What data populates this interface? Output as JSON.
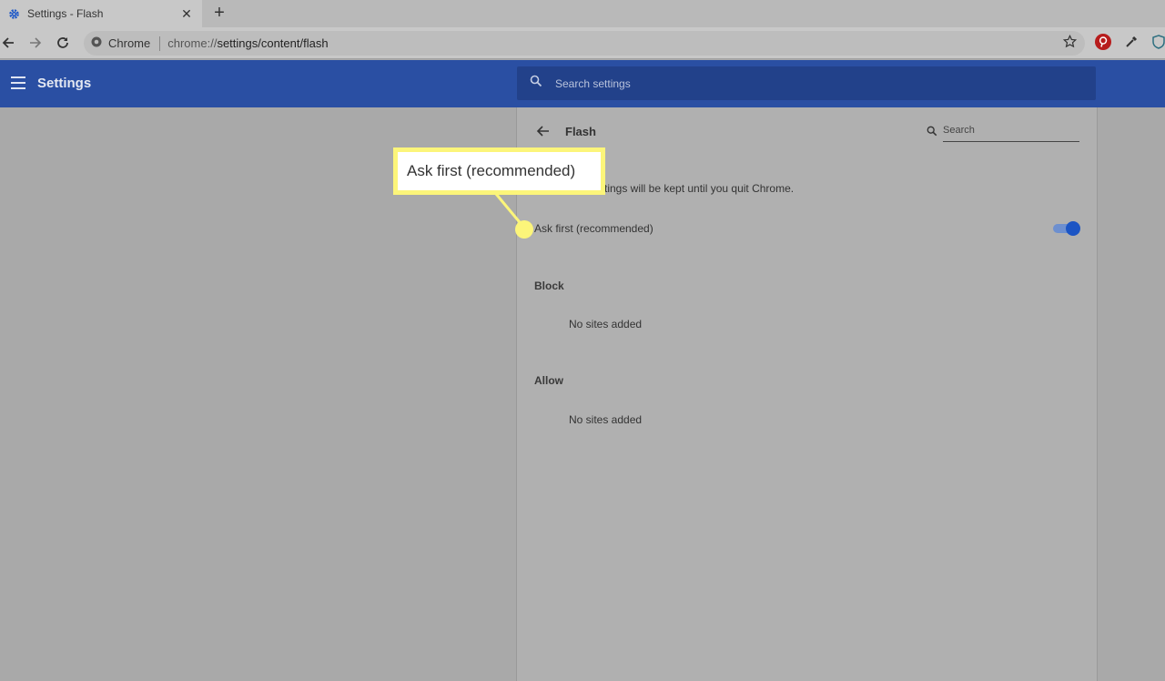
{
  "tab": {
    "title": "Settings - Flash",
    "close": "✕",
    "new_tab": "+"
  },
  "toolbar": {
    "site_chip": "Chrome",
    "url_prefix": "chrome://",
    "url_path": "settings/content/flash"
  },
  "header": {
    "title": "Settings",
    "search_placeholder": "Search settings"
  },
  "page": {
    "title": "Flash",
    "search_placeholder": "Search",
    "note": "tings will be kept until you quit Chrome.",
    "ask_first_label": "Ask first (recommended)",
    "ask_first_enabled": true,
    "sections": [
      {
        "heading": "Block",
        "empty_text": "No sites added"
      },
      {
        "heading": "Allow",
        "empty_text": "No sites added"
      }
    ]
  },
  "callout": {
    "text": "Ask first (recommended)"
  },
  "colors": {
    "header_blue": "#2a4fa3",
    "toggle_blue": "#1c55c4",
    "callout_yellow": "#fcf57a"
  },
  "icons": [
    "gear-icon",
    "close-icon",
    "plus-icon",
    "back-icon",
    "forward-icon",
    "reload-icon",
    "chrome-icon",
    "star-icon",
    "pinterest-icon",
    "eyedropper-icon",
    "shield-icon",
    "menu-icon",
    "search-icon",
    "arrow-left-icon"
  ]
}
